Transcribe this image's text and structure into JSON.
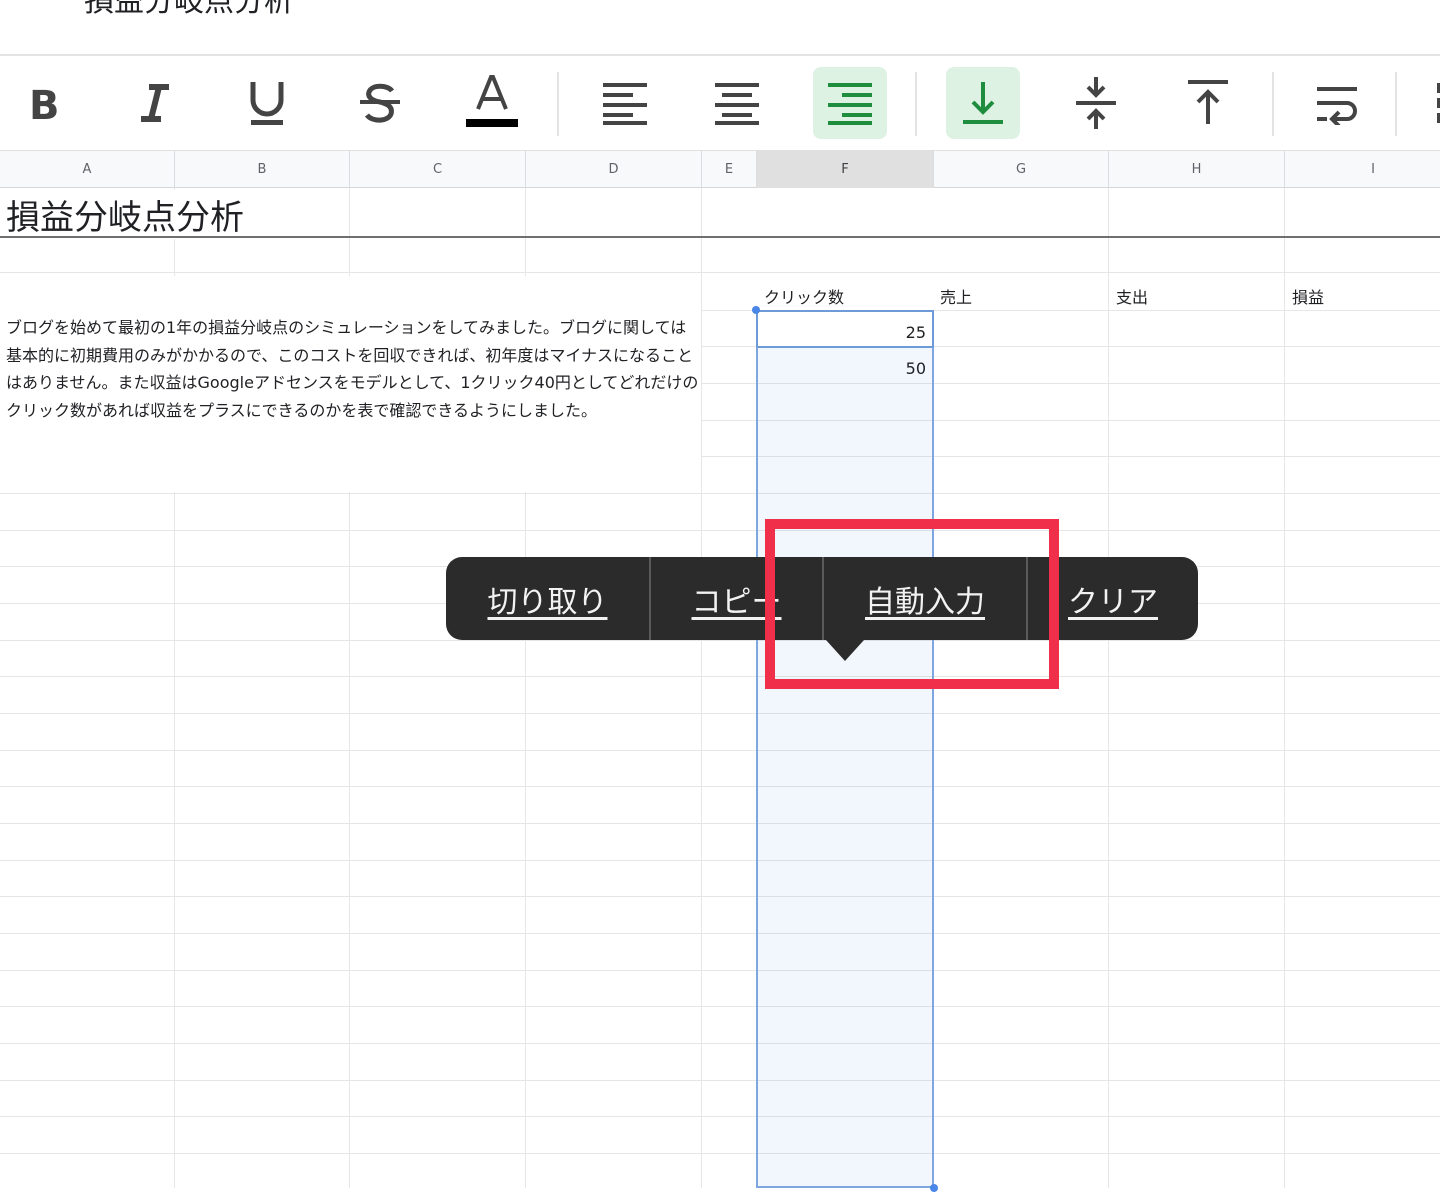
{
  "document": {
    "title": "損益分岐点分析"
  },
  "toolbar": {
    "buttons": [
      {
        "name": "bold-button",
        "icon": "bold-icon",
        "active": false
      },
      {
        "name": "italic-button",
        "icon": "italic-icon",
        "active": false
      },
      {
        "name": "underline-button",
        "icon": "underline-icon",
        "active": false
      },
      {
        "name": "strikethrough-button",
        "icon": "strikethrough-icon",
        "active": false
      },
      {
        "name": "text-color-button",
        "icon": "text-color-icon",
        "active": false
      },
      {
        "name": "align-left-button",
        "icon": "align-left-icon",
        "active": false
      },
      {
        "name": "align-center-button",
        "icon": "align-center-icon",
        "active": false
      },
      {
        "name": "align-right-button",
        "icon": "align-right-icon",
        "active": true
      },
      {
        "name": "valign-bottom-button",
        "icon": "valign-bottom-icon",
        "active": true
      },
      {
        "name": "valign-middle-button",
        "icon": "valign-middle-icon",
        "active": false
      },
      {
        "name": "valign-top-button",
        "icon": "valign-top-icon",
        "active": false
      },
      {
        "name": "wrap-text-button",
        "icon": "wrap-text-icon",
        "active": false
      }
    ],
    "accent_color": "#1e8e3e",
    "active_bg": "#ddf2e3"
  },
  "columns": [
    "A",
    "B",
    "C",
    "D",
    "E",
    "F",
    "G",
    "H",
    "I"
  ],
  "selected_column": "F",
  "sheet": {
    "title": "損益分岐点分析",
    "description": "ブログを始めて最初の1年の損益分岐点のシミュレーションをしてみました。ブログに関しては基本的に初期費用のみがかかるので、このコストを回収できれば、初年度はマイナスになることはありません。また収益はGoogleアドセンスをモデルとして、1クリック40円としてどれだけのクリック数があれば収益をプラスにできるのかを表で確認できるようにしました。",
    "headers": {
      "clicks": "クリック数",
      "sales": "売上",
      "expense": "支出",
      "profit": "損益"
    },
    "values": [
      "25",
      "50"
    ]
  },
  "context_menu": {
    "items": [
      "切り取り",
      "コピー",
      "自動入力",
      "クリア"
    ],
    "highlighted": "自動入力",
    "highlight_color": "#f0304a"
  }
}
